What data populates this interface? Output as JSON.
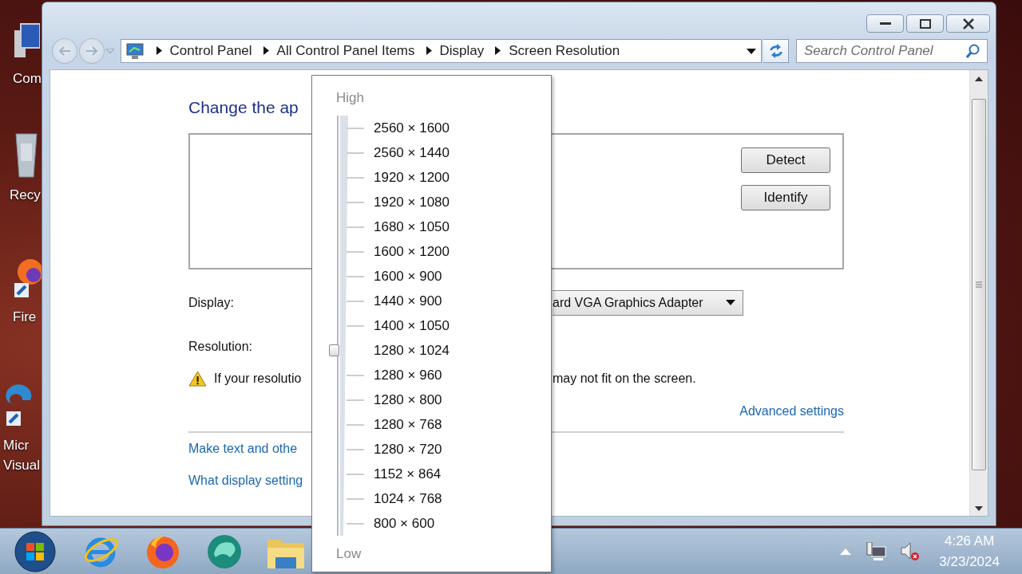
{
  "desktop_icons": [
    {
      "kind": "computer",
      "label_lines": [
        "Com"
      ]
    },
    {
      "kind": "recycle-bin",
      "label_lines": [
        "Recy"
      ]
    },
    {
      "kind": "fox",
      "label_lines": [
        "Fire"
      ]
    },
    {
      "kind": "swirl",
      "label_lines": [
        "Micr",
        "Visual"
      ]
    }
  ],
  "navigation": {
    "back_enabled": false,
    "forward_enabled": false
  },
  "address_bar": {
    "breadcrumbs": [
      "Control Panel",
      "All Control Panel Items",
      "Display",
      "Screen Resolution"
    ]
  },
  "search": {
    "placeholder": "Search Control Panel"
  },
  "content": {
    "heading": "Change the ap",
    "buttons": [
      "Detect",
      "Identify"
    ],
    "display_label": "Display:",
    "display_value": "ard VGA Graphics Adapter",
    "resolution_label": "Resolution:",
    "warning_start": "If your resolutio",
    "warning_end": "may not fit on the screen.",
    "advanced_link": "Advanced settings",
    "links": [
      "Make text and othe",
      "What display setting"
    ]
  },
  "resolution_menu": {
    "high_label": "High",
    "low_label": "Low",
    "options": [
      {
        "label": "2560 × 1600",
        "selected": false
      },
      {
        "label": "2560 × 1440",
        "selected": false
      },
      {
        "label": "1920 × 1200",
        "selected": false
      },
      {
        "label": "1920 × 1080",
        "selected": false
      },
      {
        "label": "1680 × 1050",
        "selected": false
      },
      {
        "label": "1600 × 1200",
        "selected": false
      },
      {
        "label": "1600 × 900",
        "selected": false
      },
      {
        "label": "1440 × 900",
        "selected": false
      },
      {
        "label": "1400 × 1050",
        "selected": false
      },
      {
        "label": "1280 × 1024",
        "selected": true
      },
      {
        "label": "1280 × 960",
        "selected": false
      },
      {
        "label": "1280 × 800",
        "selected": false
      },
      {
        "label": "1280 × 768",
        "selected": false
      },
      {
        "label": "1280 × 720",
        "selected": false
      },
      {
        "label": "1152 × 864",
        "selected": false
      },
      {
        "label": "1024 × 768",
        "selected": false
      },
      {
        "label": "800 × 600",
        "selected": false
      }
    ]
  },
  "taskbar": {
    "apps": [
      {
        "kind": "start"
      },
      {
        "kind": "ie"
      },
      {
        "kind": "fox"
      },
      {
        "kind": "swirl"
      },
      {
        "kind": "folder"
      }
    ],
    "clock": {
      "time": "4:26 AM",
      "date": "3/23/2024"
    }
  }
}
